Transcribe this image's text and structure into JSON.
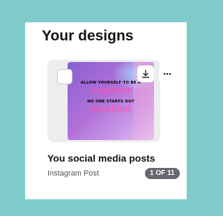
{
  "section_title": "Your designs",
  "design": {
    "name": "You social media posts",
    "type": "Instagram Post",
    "pager": "1 OF 11",
    "thumbnail_text": {
      "line1": "ALLOW YOURSELF TO BE A",
      "line2": "beginner",
      "line3": "NO ONE STARTS OUT",
      "line4": "excellent"
    }
  },
  "icons": {
    "download": "download-icon",
    "more": "more-options-icon",
    "select": "checkbox-icon"
  },
  "colors": {
    "background": "#7ecbc9",
    "card": "#ffffff",
    "accent_pink": "#ff4fb0"
  }
}
